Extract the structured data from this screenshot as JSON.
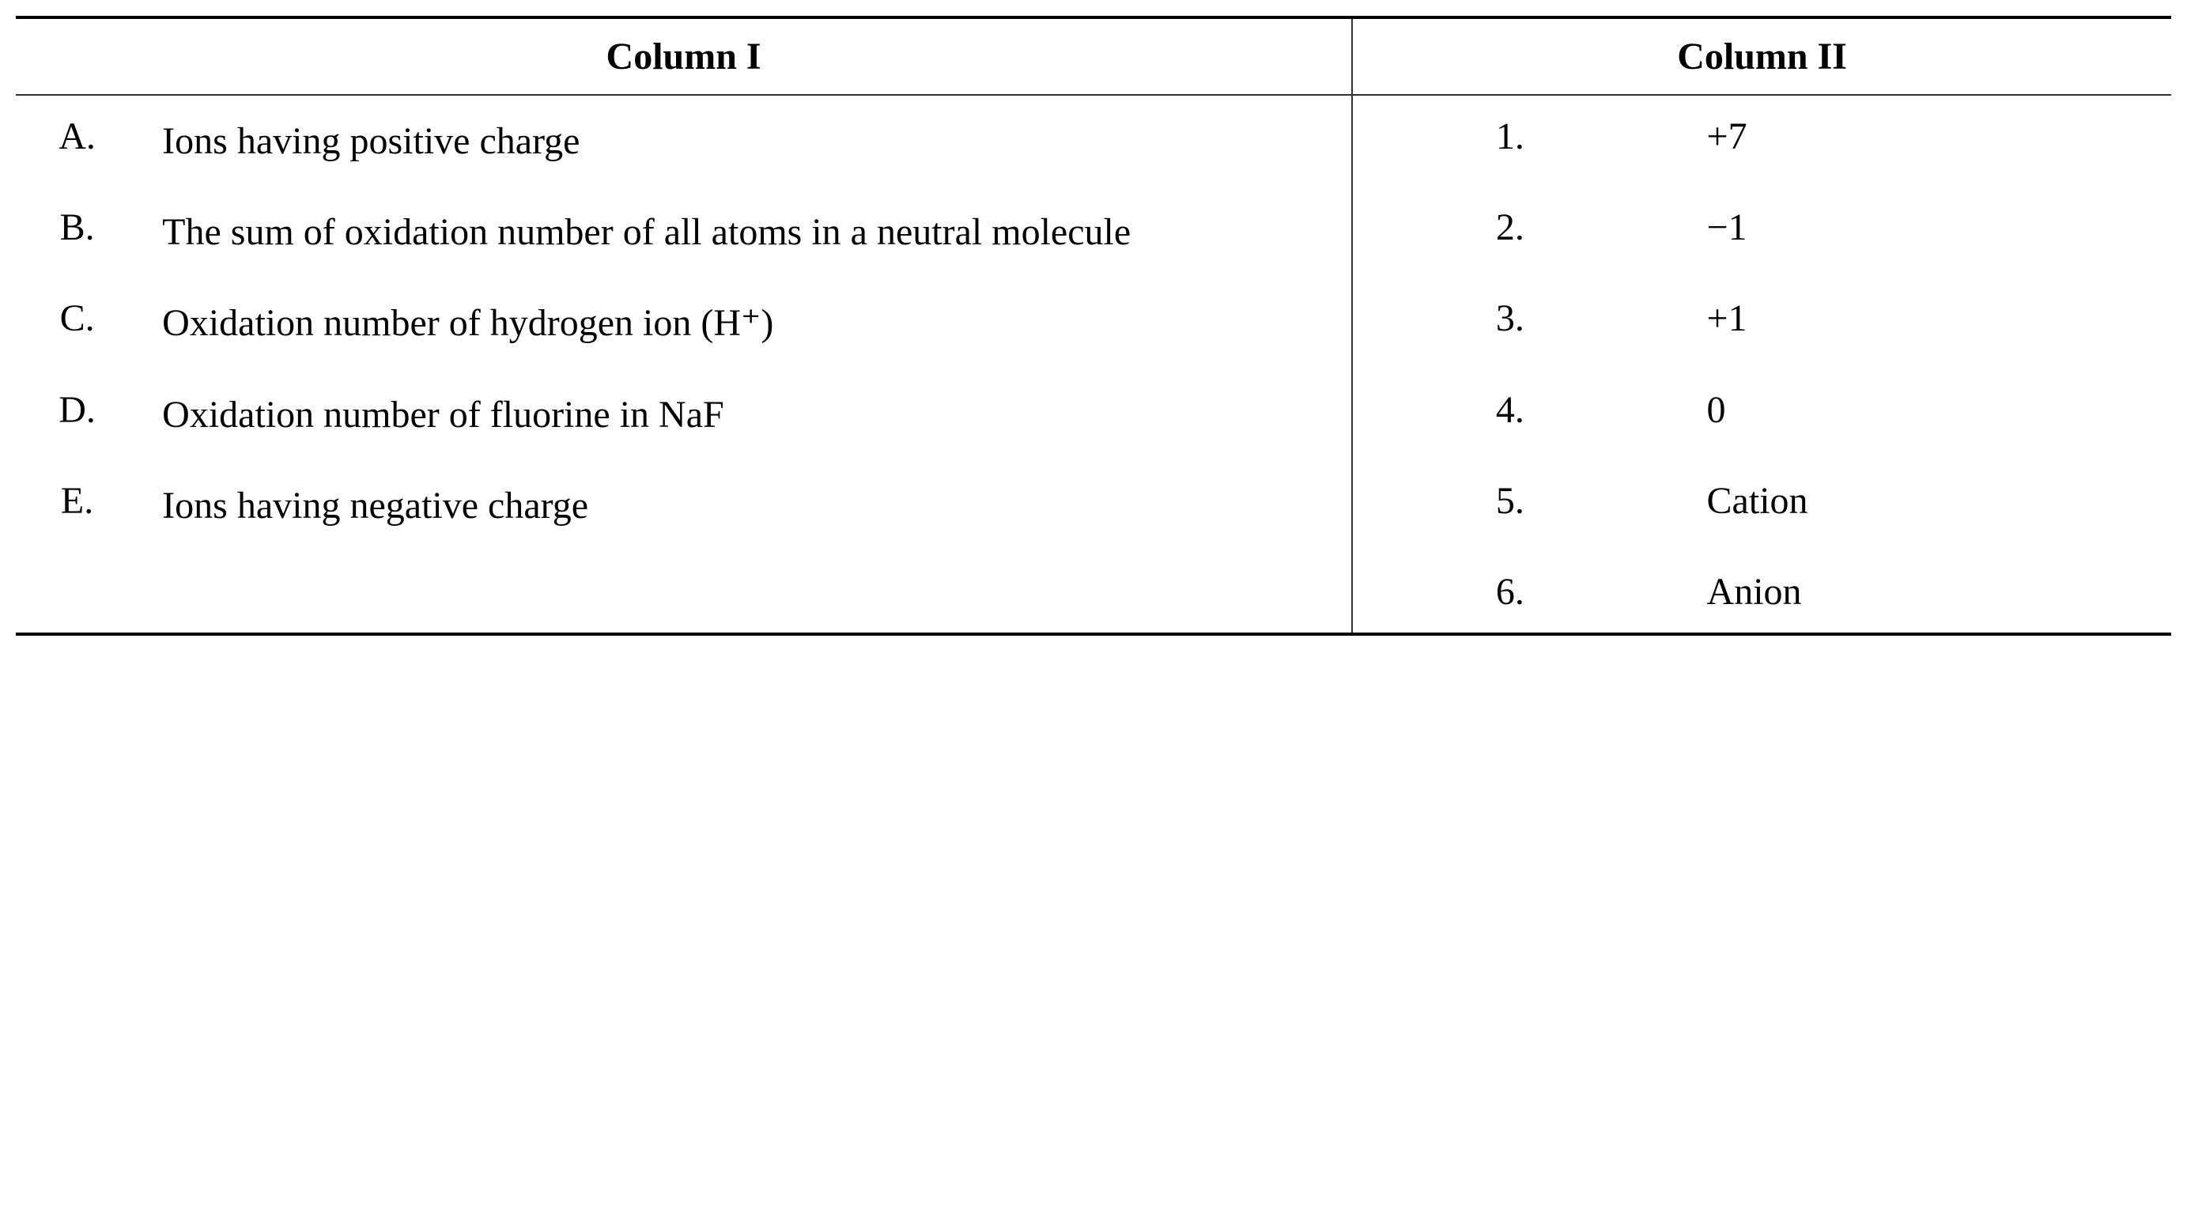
{
  "table": {
    "headers": {
      "col1": "Column I",
      "col2": "Column II"
    },
    "column1": [
      {
        "letter": "A.",
        "text": "Ions having positive charge"
      },
      {
        "letter": "B.",
        "text": "The sum of oxidation number of all atoms in a neutral molecule"
      },
      {
        "letter": "C.",
        "text": "Oxidation number of hydrogen ion (H⁺)"
      },
      {
        "letter": "D.",
        "text": "Oxidation number of fluorine in NaF"
      },
      {
        "letter": "E.",
        "text": "Ions having negative charge"
      },
      {
        "letter": "",
        "text": ""
      }
    ],
    "column2": [
      {
        "number": "1.",
        "value": "+7"
      },
      {
        "number": "2.",
        "value": "−1"
      },
      {
        "number": "3.",
        "value": "+1"
      },
      {
        "number": "4.",
        "value": "0"
      },
      {
        "number": "5.",
        "value": "Cation"
      },
      {
        "number": "6.",
        "value": "Anion"
      }
    ]
  }
}
